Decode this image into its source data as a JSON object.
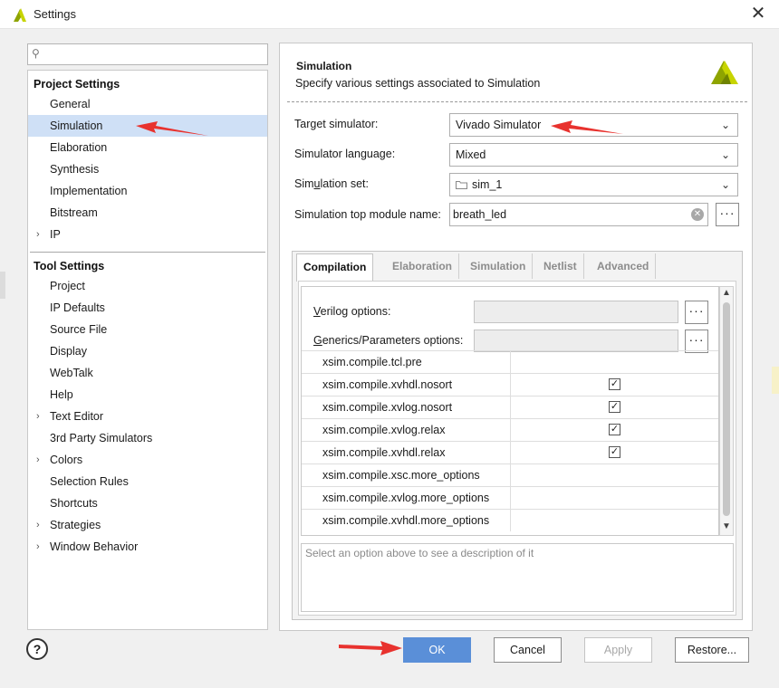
{
  "window": {
    "title": "Settings",
    "close_glyph": "✕"
  },
  "search": {
    "icon": "search-icon",
    "placeholder": ""
  },
  "nav": {
    "project_settings": {
      "heading": "Project Settings",
      "items": [
        {
          "label": "General",
          "expandable": false
        },
        {
          "label": "Simulation",
          "expandable": false,
          "selected": true
        },
        {
          "label": "Elaboration",
          "expandable": false
        },
        {
          "label": "Synthesis",
          "expandable": false
        },
        {
          "label": "Implementation",
          "expandable": false
        },
        {
          "label": "Bitstream",
          "expandable": false
        },
        {
          "label": "IP",
          "expandable": true
        }
      ]
    },
    "tool_settings": {
      "heading": "Tool Settings",
      "items": [
        {
          "label": "Project",
          "expandable": false
        },
        {
          "label": "IP Defaults",
          "expandable": false
        },
        {
          "label": "Source File",
          "expandable": false
        },
        {
          "label": "Display",
          "expandable": false
        },
        {
          "label": "WebTalk",
          "expandable": false
        },
        {
          "label": "Help",
          "expandable": false
        },
        {
          "label": "Text Editor",
          "expandable": true
        },
        {
          "label": "3rd Party Simulators",
          "expandable": false
        },
        {
          "label": "Colors",
          "expandable": true
        },
        {
          "label": "Selection Rules",
          "expandable": false
        },
        {
          "label": "Shortcuts",
          "expandable": false
        },
        {
          "label": "Strategies",
          "expandable": true
        },
        {
          "label": "Window Behavior",
          "expandable": true
        }
      ]
    }
  },
  "panel": {
    "title": "Simulation",
    "subtitle": "Specify various settings associated to Simulation",
    "fields": {
      "target_simulator": {
        "label": "Target simulator:",
        "value": "Vivado Simulator"
      },
      "simulator_language": {
        "label": "Simulator language:",
        "value": "Mixed"
      },
      "simulation_set": {
        "label_pre": "Sim",
        "label_u": "u",
        "label_post": "lation set:",
        "value": "sim_1"
      },
      "top_module": {
        "label": "Simulation top module name:",
        "value": "breath_led"
      }
    },
    "tabs": [
      "Compilation",
      "Elaboration",
      "Simulation",
      "Netlist",
      "Advanced"
    ],
    "active_tab": "Compilation",
    "verilog_options": {
      "label_u": "V",
      "label_rest": "erilog options:"
    },
    "generics_options": {
      "label_u": "G",
      "label_rest": "enerics/Parameters options:"
    },
    "properties": [
      {
        "name": "xsim.compile.tcl.pre",
        "checked": null
      },
      {
        "name": "xsim.compile.xvhdl.nosort",
        "checked": true
      },
      {
        "name": "xsim.compile.xvlog.nosort",
        "checked": true
      },
      {
        "name": "xsim.compile.xvlog.relax",
        "checked": true
      },
      {
        "name": "xsim.compile.xvhdl.relax",
        "checked": true
      },
      {
        "name": "xsim.compile.xsc.more_options",
        "checked": null
      },
      {
        "name": "xsim.compile.xvlog.more_options",
        "checked": null
      },
      {
        "name": "xsim.compile.xvhdl.more_options",
        "checked": null
      }
    ],
    "description_placeholder": "Select an option above to see a description of it"
  },
  "buttons": {
    "help": "?",
    "ok": "OK",
    "cancel": "Cancel",
    "apply": "Apply",
    "restore": "Restore..."
  },
  "colors": {
    "accent": "#5a8fd8",
    "selection": "#cfe0f6",
    "annotation_arrow": "#e8322e",
    "logo_yellow": "#b5c400"
  }
}
